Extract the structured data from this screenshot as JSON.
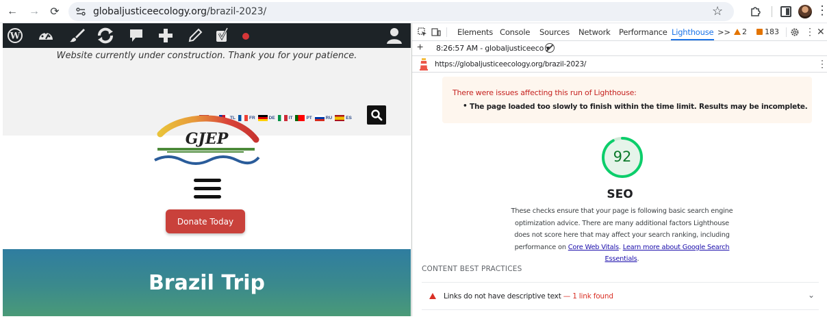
{
  "browser": {
    "url_host": "globaljusticeecology.org",
    "url_path": "/brazil-2023/"
  },
  "site": {
    "notice": "Website currently under construction. Thank you for your patience.",
    "languages": [
      {
        "code": "EN",
        "flag_colors": [
          "#b22234",
          "#ffffff",
          "#3c3b6e"
        ]
      },
      {
        "code": "TL",
        "flag_colors": [
          "#0038a8",
          "#ce1126",
          "#ffffff"
        ]
      },
      {
        "code": "FR",
        "flag_colors": [
          "#0055a4",
          "#ffffff",
          "#ef4135"
        ]
      },
      {
        "code": "DE",
        "flag_colors": [
          "#000000",
          "#dd0000",
          "#ffce00"
        ]
      },
      {
        "code": "IT",
        "flag_colors": [
          "#009246",
          "#ffffff",
          "#ce2b37"
        ]
      },
      {
        "code": "PT",
        "flag_colors": [
          "#006600",
          "#ff0000",
          "#ff0000"
        ]
      },
      {
        "code": "RU",
        "flag_colors": [
          "#ffffff",
          "#0039a6",
          "#d52b1e"
        ]
      },
      {
        "code": "ES",
        "flag_colors": [
          "#aa151b",
          "#f1bf00",
          "#aa151b"
        ]
      }
    ],
    "logo_text": "GJEP",
    "donate_label": "Donate Today",
    "hero_title": "Brazil Trip",
    "colors": {
      "donate": "#c9413b",
      "admin_bar": "#1d2327"
    }
  },
  "devtools": {
    "tabs": [
      "Elements",
      "Console",
      "Sources",
      "Network",
      "Performance",
      "Lighthouse"
    ],
    "active_tab": "Lighthouse",
    "more_tabs": ">>",
    "warnings": "2",
    "issues": "183",
    "run_time": "8:26:57 AM - globaljusticeeco ▾",
    "report_url": "https://globaljusticeecology.org/brazil-2023/",
    "warning_title": "There were issues affecting this run of Lighthouse:",
    "warning_item": "The page loaded too slowly to finish within the time limit. Results may be incomplete.",
    "score": "92",
    "score_fraction": 0.92,
    "category": "SEO",
    "desc_before": "These checks ensure that your page is following basic search engine optimization advice. There are many additional factors Lighthouse does not score here that may affect your search ranking, including performance on ",
    "desc_link1": "Core Web Vitals",
    "desc_mid": ". ",
    "desc_link2": "Learn more about Google Search Essentials",
    "desc_after": ".",
    "section": "CONTENT BEST PRACTICES",
    "audit_text": "Links do not have descriptive text",
    "audit_dash": " — ",
    "audit_count": "1 link found",
    "colors": {
      "accent": "#1a73e8",
      "score_green": "#0c7a2b",
      "fail_red": "#d93025",
      "warning_orange": "#e37400"
    }
  }
}
